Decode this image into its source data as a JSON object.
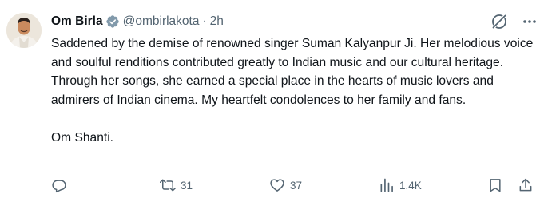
{
  "author": {
    "name": "Om Birla",
    "handle": "@ombirlakota",
    "separator": "·",
    "time": "2h"
  },
  "tweet": {
    "paragraph1": "Saddened by the demise of renowned singer Suman Kalyanpur Ji. Her melodious voice and soulful renditions contributed greatly to Indian music and our cultural heritage. Through her songs, she earned a special place in the hearts of music lovers and admirers of Indian cinema. My heartfelt condolences to her family and fans.",
    "paragraph2": "Om Shanti."
  },
  "actions": {
    "reply_count": "",
    "retweet_count": "31",
    "like_count": "37",
    "views_count": "1.4K"
  },
  "icons": {
    "verified": "verified-badge-icon",
    "grok": "grok-icon",
    "more": "more-icon",
    "reply": "reply-icon",
    "retweet": "retweet-icon",
    "like": "like-icon",
    "views": "views-icon",
    "bookmark": "bookmark-icon",
    "share": "share-icon"
  },
  "colors": {
    "text": "#0f1419",
    "secondary": "#536471",
    "verified_badge": "#829aab"
  }
}
